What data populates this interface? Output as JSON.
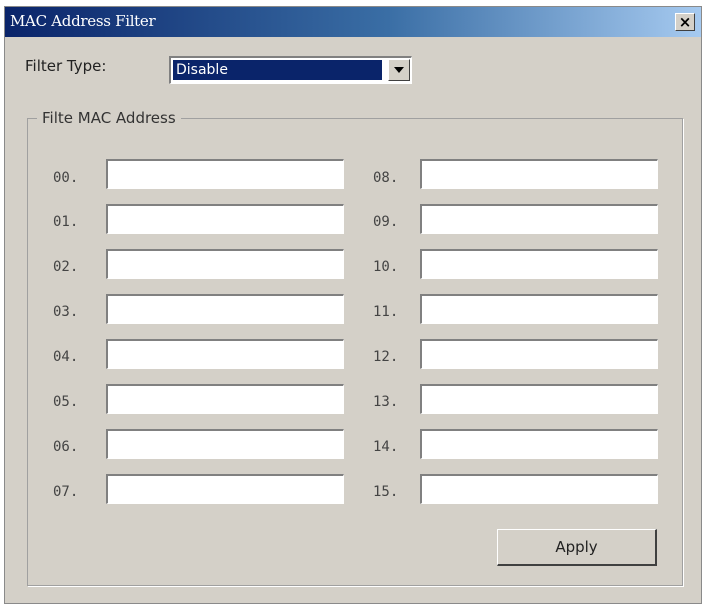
{
  "window": {
    "title": "MAC Address Filter",
    "close_glyph": "×",
    "colors": {
      "titlebar_start": "#0a246a",
      "titlebar_end": "#a6caf0",
      "face": "#d4d0c8",
      "selection": "#0a246a"
    }
  },
  "filter": {
    "label": "Filter Type:",
    "selected": "Disable",
    "dropdown_icon": "chevron-down-icon"
  },
  "group": {
    "legend": "Filte MAC Address"
  },
  "entries": [
    {
      "label": "00.",
      "value": ""
    },
    {
      "label": "01.",
      "value": ""
    },
    {
      "label": "02.",
      "value": ""
    },
    {
      "label": "03.",
      "value": ""
    },
    {
      "label": "04.",
      "value": ""
    },
    {
      "label": "05.",
      "value": ""
    },
    {
      "label": "06.",
      "value": ""
    },
    {
      "label": "07.",
      "value": ""
    },
    {
      "label": "08.",
      "value": ""
    },
    {
      "label": "09.",
      "value": ""
    },
    {
      "label": "10.",
      "value": ""
    },
    {
      "label": "11.",
      "value": ""
    },
    {
      "label": "12.",
      "value": ""
    },
    {
      "label": "13.",
      "value": ""
    },
    {
      "label": "14.",
      "value": ""
    },
    {
      "label": "15.",
      "value": ""
    }
  ],
  "actions": {
    "apply_label": "Apply"
  }
}
